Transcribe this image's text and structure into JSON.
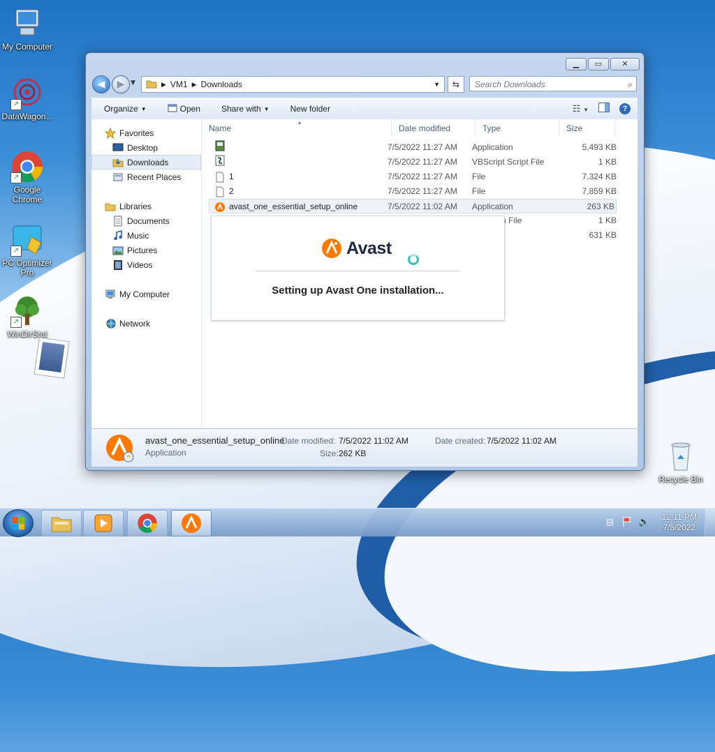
{
  "desktop": {
    "icons": [
      {
        "label": "My Computer"
      },
      {
        "label": "DataWagon..."
      },
      {
        "label": "Google Chrome"
      },
      {
        "label": "PC Optimizer Pro"
      },
      {
        "label": "WinDirStat"
      },
      {
        "label": "Recycle Bin"
      }
    ]
  },
  "window": {
    "breadcrumb": [
      "VM1",
      "Downloads"
    ],
    "search_placeholder": "Search Downloads",
    "toolbar": {
      "organize": "Organize",
      "open": "Open",
      "share_with": "Share with",
      "new_folder": "New folder"
    },
    "nav": {
      "favorites": "Favorites",
      "desktop": "Desktop",
      "downloads": "Downloads",
      "recent_places": "Recent Places",
      "libraries": "Libraries",
      "documents": "Documents",
      "music": "Music",
      "pictures": "Pictures",
      "videos": "Videos",
      "my_computer": "My Computer",
      "network": "Network"
    },
    "columns": {
      "name": "Name",
      "date": "Date modified",
      "type": "Type",
      "size": "Size"
    },
    "files": [
      {
        "name": "",
        "date": "7/5/2022 11:27 AM",
        "type": "Application",
        "size": "5,493 KB"
      },
      {
        "name": "",
        "date": "7/5/2022 11:27 AM",
        "type": "VBScript Script File",
        "size": "1 KB"
      },
      {
        "name": "1",
        "date": "7/5/2022 11:27 AM",
        "type": "File",
        "size": "7,324 KB"
      },
      {
        "name": "2",
        "date": "7/5/2022 11:27 AM",
        "type": "File",
        "size": "7,859 KB"
      },
      {
        "name": "avast_one_essential_setup_online",
        "date": "7/5/2022 11:02 AM",
        "type": "Application",
        "size": "263 KB"
      },
      {
        "name": "",
        "date": "",
        "type": "ws Batch File",
        "size": "1 KB"
      },
      {
        "name": "",
        "date": "",
        "type": "ation",
        "size": "631 KB"
      }
    ],
    "details": {
      "name": "avast_one_essential_setup_online",
      "type": "Application",
      "date_modified_label": "Date modified:",
      "date_modified": "7/5/2022 11:02 AM",
      "date_created_label": "Date created:",
      "date_created": "7/5/2022 11:02 AM",
      "size_label": "Size:",
      "size": "262 KB"
    }
  },
  "popup": {
    "brand": "Avast",
    "message": "Setting up Avast One installation...",
    "brand_color": "#ff7800"
  },
  "taskbar": {
    "time": "12:11 PM",
    "date": "7/5/2022"
  }
}
